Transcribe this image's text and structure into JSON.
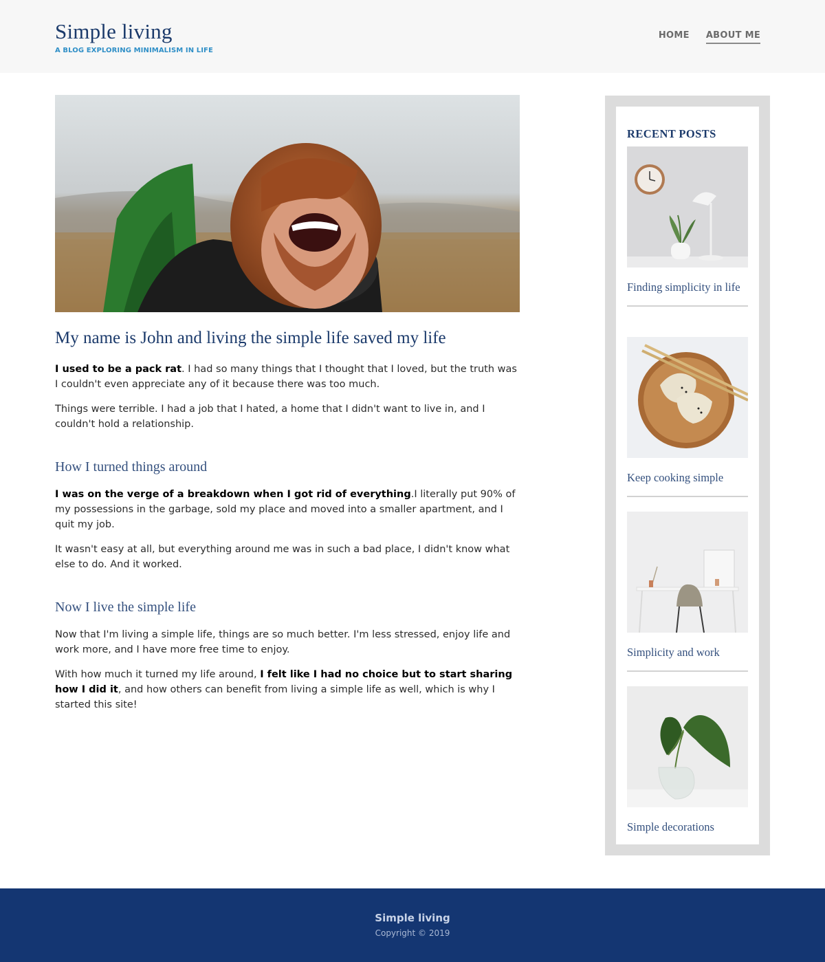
{
  "header": {
    "title": "Simple living",
    "tagline": "A BLOG EXPLORING MINIMALISM IN LIFE",
    "nav": [
      {
        "label": "HOME"
      },
      {
        "label": "ABOUT ME",
        "active": true
      }
    ]
  },
  "main": {
    "hero_image": "smiling-man-with-backpack-photo",
    "title": "My name is John and living the simple life saved my life",
    "intro": {
      "p1_bold": "I used to be a pack rat",
      "p1_rest": ". I had so many things that I thought that I loved, but the truth was I couldn't even appreciate any of it because there was too much.",
      "p2": "Things were terrible. I had a job that I hated, a home that I didn't want to live in, and I couldn't hold a relationship."
    },
    "section1": {
      "heading": "How I turned things around",
      "p1_bold": "I was on the verge of a breakdown when I got rid of everything",
      "p1_rest": ".I literally put 90% of my possessions in the garbage, sold my place and moved into a smaller apartment, and I quit my job.",
      "p2": "It wasn't easy at all, but everything around me was in such a bad place, I didn't know what else to do. And it worked."
    },
    "section2": {
      "heading": "Now I live the simple life",
      "p1": "Now that I'm living a simple life, things are so much better. I'm less stressed, enjoy life and work more, and I have more free time to enjoy.",
      "p2_start": "With how much it turned my life around, ",
      "p2_bold": "I felt like I had no choice but to start sharing how I did it",
      "p2_rest": ", and how others can benefit from living a simple life as well, which is why I started this site!"
    }
  },
  "sidebar": {
    "heading": "RECENT POSTS",
    "posts": [
      {
        "title": "Finding simplicity in life",
        "image": "clock-lamp-plant-photo"
      },
      {
        "title": "Keep cooking simple",
        "image": "dumplings-bowl-photo"
      },
      {
        "title": "Simplicity and work",
        "image": "desk-chair-photo"
      },
      {
        "title": "Simple decorations",
        "image": "leaves-in-vase-photo"
      }
    ]
  },
  "footer": {
    "title": "Simple living",
    "copyright": "Copyright © 2019"
  },
  "colors": {
    "brand_navy": "#1b3a6b",
    "tagline_blue": "#2f8fc7",
    "footer_bg": "#143672",
    "sidebar_frame": "#dcdcdc"
  }
}
